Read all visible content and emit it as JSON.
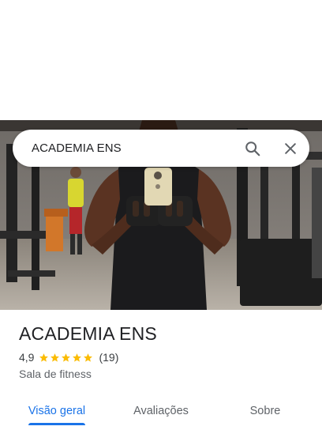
{
  "search": {
    "query": "ACADEMIA ENS",
    "search_icon": "search-icon",
    "close_icon": "close-icon"
  },
  "hero_photo": {
    "description_icon": "gym-mirror-selfie-photo"
  },
  "place": {
    "name": "ACADEMIA ENS",
    "rating": "4,9",
    "stars_value": 4.9,
    "stars_max": 5,
    "review_count": "(19)",
    "category": "Sala de fitness"
  },
  "tabs": [
    {
      "label": "Visão geral",
      "active": true
    },
    {
      "label": "Avaliações",
      "active": false
    },
    {
      "label": "Sobre",
      "active": false
    }
  ],
  "colors": {
    "accent": "#1a73e8",
    "star": "#fbbc04",
    "text_primary": "#202124",
    "text_secondary": "#5f6368"
  }
}
